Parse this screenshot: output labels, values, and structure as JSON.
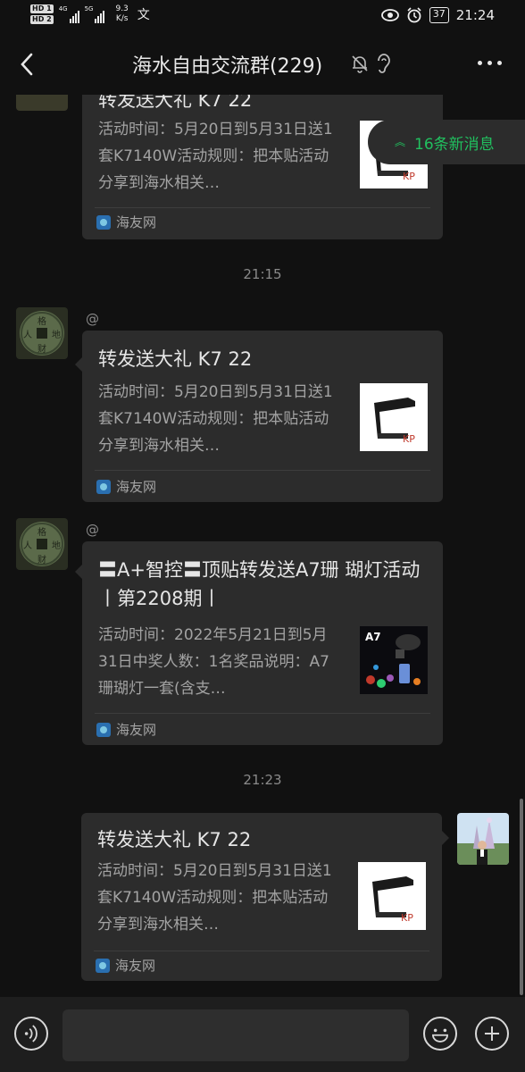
{
  "status_bar": {
    "sim1": "HD 1",
    "sim2": "HD 2",
    "net1": "4G",
    "net2": "5G",
    "speed_value": "9.3",
    "speed_unit": "K/s",
    "battery": "37",
    "time": "21:24"
  },
  "header": {
    "title": "海水自由交流群(229)"
  },
  "new_messages": "16条新消息",
  "chat": {
    "card_top": {
      "title": "转发送大礼 K7 22",
      "desc": "活动时间：5月20日到5月31日送1套K7140W活动规则：把本贴活动分享到海水相关…",
      "source": "海友网"
    },
    "time1": "21:15",
    "msg1": {
      "at": "@",
      "title": "转发送大礼 K7 22",
      "desc": "活动时间：5月20日到5月31日送1套K7140W活动规则：把本贴活动分享到海水相关…",
      "source": "海友网"
    },
    "msg2": {
      "at": "@",
      "title": "〓A+智控〓顶贴转发送A7珊 瑚灯活动丨第2208期丨",
      "desc": "活动时间：2022年5月21日到5月31日中奖人数：1名奖品说明：A7珊瑚灯一套(含支…",
      "thumb_label": "A7",
      "source": "海友网"
    },
    "time2": "21:23",
    "msg3": {
      "title": "转发送大礼 K7 22",
      "desc": "活动时间：5月20日到5月31日送1套K7140W活动规则：把本贴活动分享到海水相关…",
      "source": "海友网"
    }
  },
  "colors": {
    "background": "#111111",
    "bubble": "#2c2c2c",
    "accent_green": "#21c05f"
  }
}
